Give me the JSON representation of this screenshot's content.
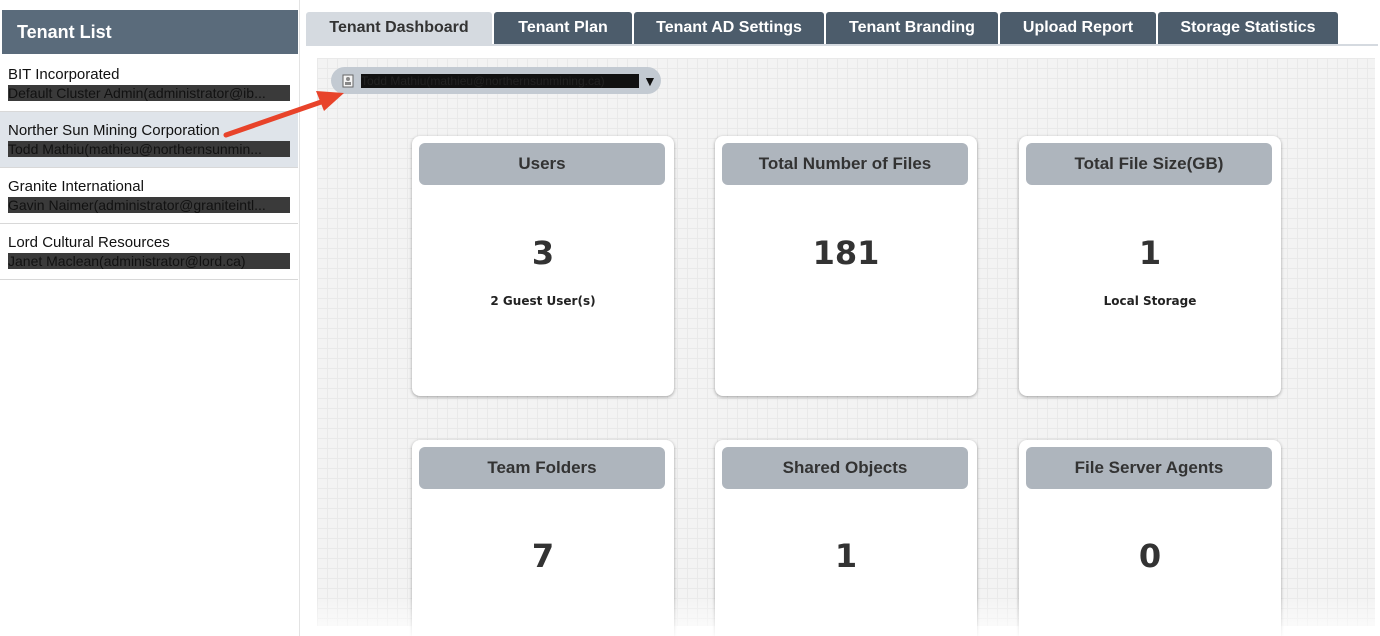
{
  "sidebar": {
    "title": "Tenant List",
    "tenants": [
      {
        "name": "BIT Incorporated",
        "admin": "Default Cluster Admin(administrator@ib..."
      },
      {
        "name": "Norther Sun Mining Corporation",
        "admin": "Todd Mathiu(mathieu@northernsunmin..."
      },
      {
        "name": "Granite International",
        "admin": "Gavin Naimer(administrator@graniteintl..."
      },
      {
        "name": "Lord Cultural Resources",
        "admin": "Janet Maclean(administrator@lord.ca)"
      }
    ]
  },
  "tabs": [
    {
      "label": "Tenant Dashboard",
      "active": true
    },
    {
      "label": "Tenant Plan"
    },
    {
      "label": "Tenant AD Settings"
    },
    {
      "label": "Tenant Branding"
    },
    {
      "label": "Upload Report"
    },
    {
      "label": "Storage Statistics"
    }
  ],
  "user_selector": {
    "value": "Todd Mathiu(mathieu@northernsunmining.ca)",
    "caret": "▼"
  },
  "cards": [
    {
      "title": "Users",
      "value": "3",
      "sub": "2 Guest User(s)"
    },
    {
      "title": "Total Number of Files",
      "value": "181",
      "sub": ""
    },
    {
      "title": "Total File Size(GB)",
      "value": "1",
      "sub": "Local Storage"
    },
    {
      "title": "Team Folders",
      "value": "7",
      "sub": ""
    },
    {
      "title": "Shared Objects",
      "value": "1",
      "sub": ""
    },
    {
      "title": "File Server Agents",
      "value": "0",
      "sub": ""
    }
  ],
  "colors": {
    "sidebar_header": "#5a6b7b",
    "tab": "#4c5c6b",
    "tab_active": "#d5dae0",
    "card_header": "#aeb5bd",
    "annotation_arrow": "#e8432a"
  }
}
